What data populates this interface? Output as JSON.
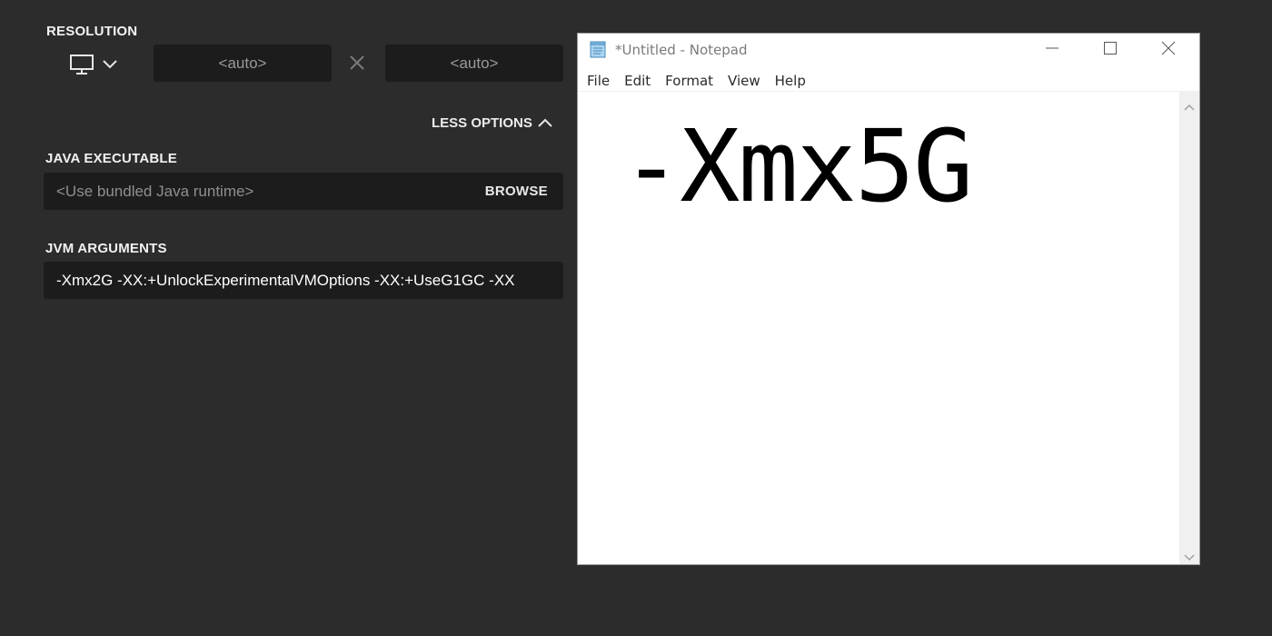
{
  "launcher": {
    "resolution_label": "RESOLUTION",
    "resolution_width": "<auto>",
    "resolution_height": "<auto>",
    "less_options_label": "LESS OPTIONS",
    "java_label": "JAVA EXECUTABLE",
    "java_value": "<Use bundled Java runtime>",
    "browse_label": "BROWSE",
    "jvm_label": "JVM ARGUMENTS",
    "jvm_value": "-Xmx2G -XX:+UnlockExperimentalVMOptions -XX:+UseG1GC -XX"
  },
  "icons": {
    "monitor": "monitor-icon",
    "dropdown": "chevron-down-icon",
    "times": "times-icon",
    "collapse": "chevron-up-icon"
  },
  "notepad": {
    "title": "*Untitled - Notepad",
    "menu": [
      "File",
      "Edit",
      "Format",
      "View",
      "Help"
    ],
    "content": "-Xmx5G"
  },
  "colors": {
    "launcher_bg": "#2c2c2c",
    "field_bg": "#1c1c1c",
    "notepad_bg": "#ffffff"
  }
}
